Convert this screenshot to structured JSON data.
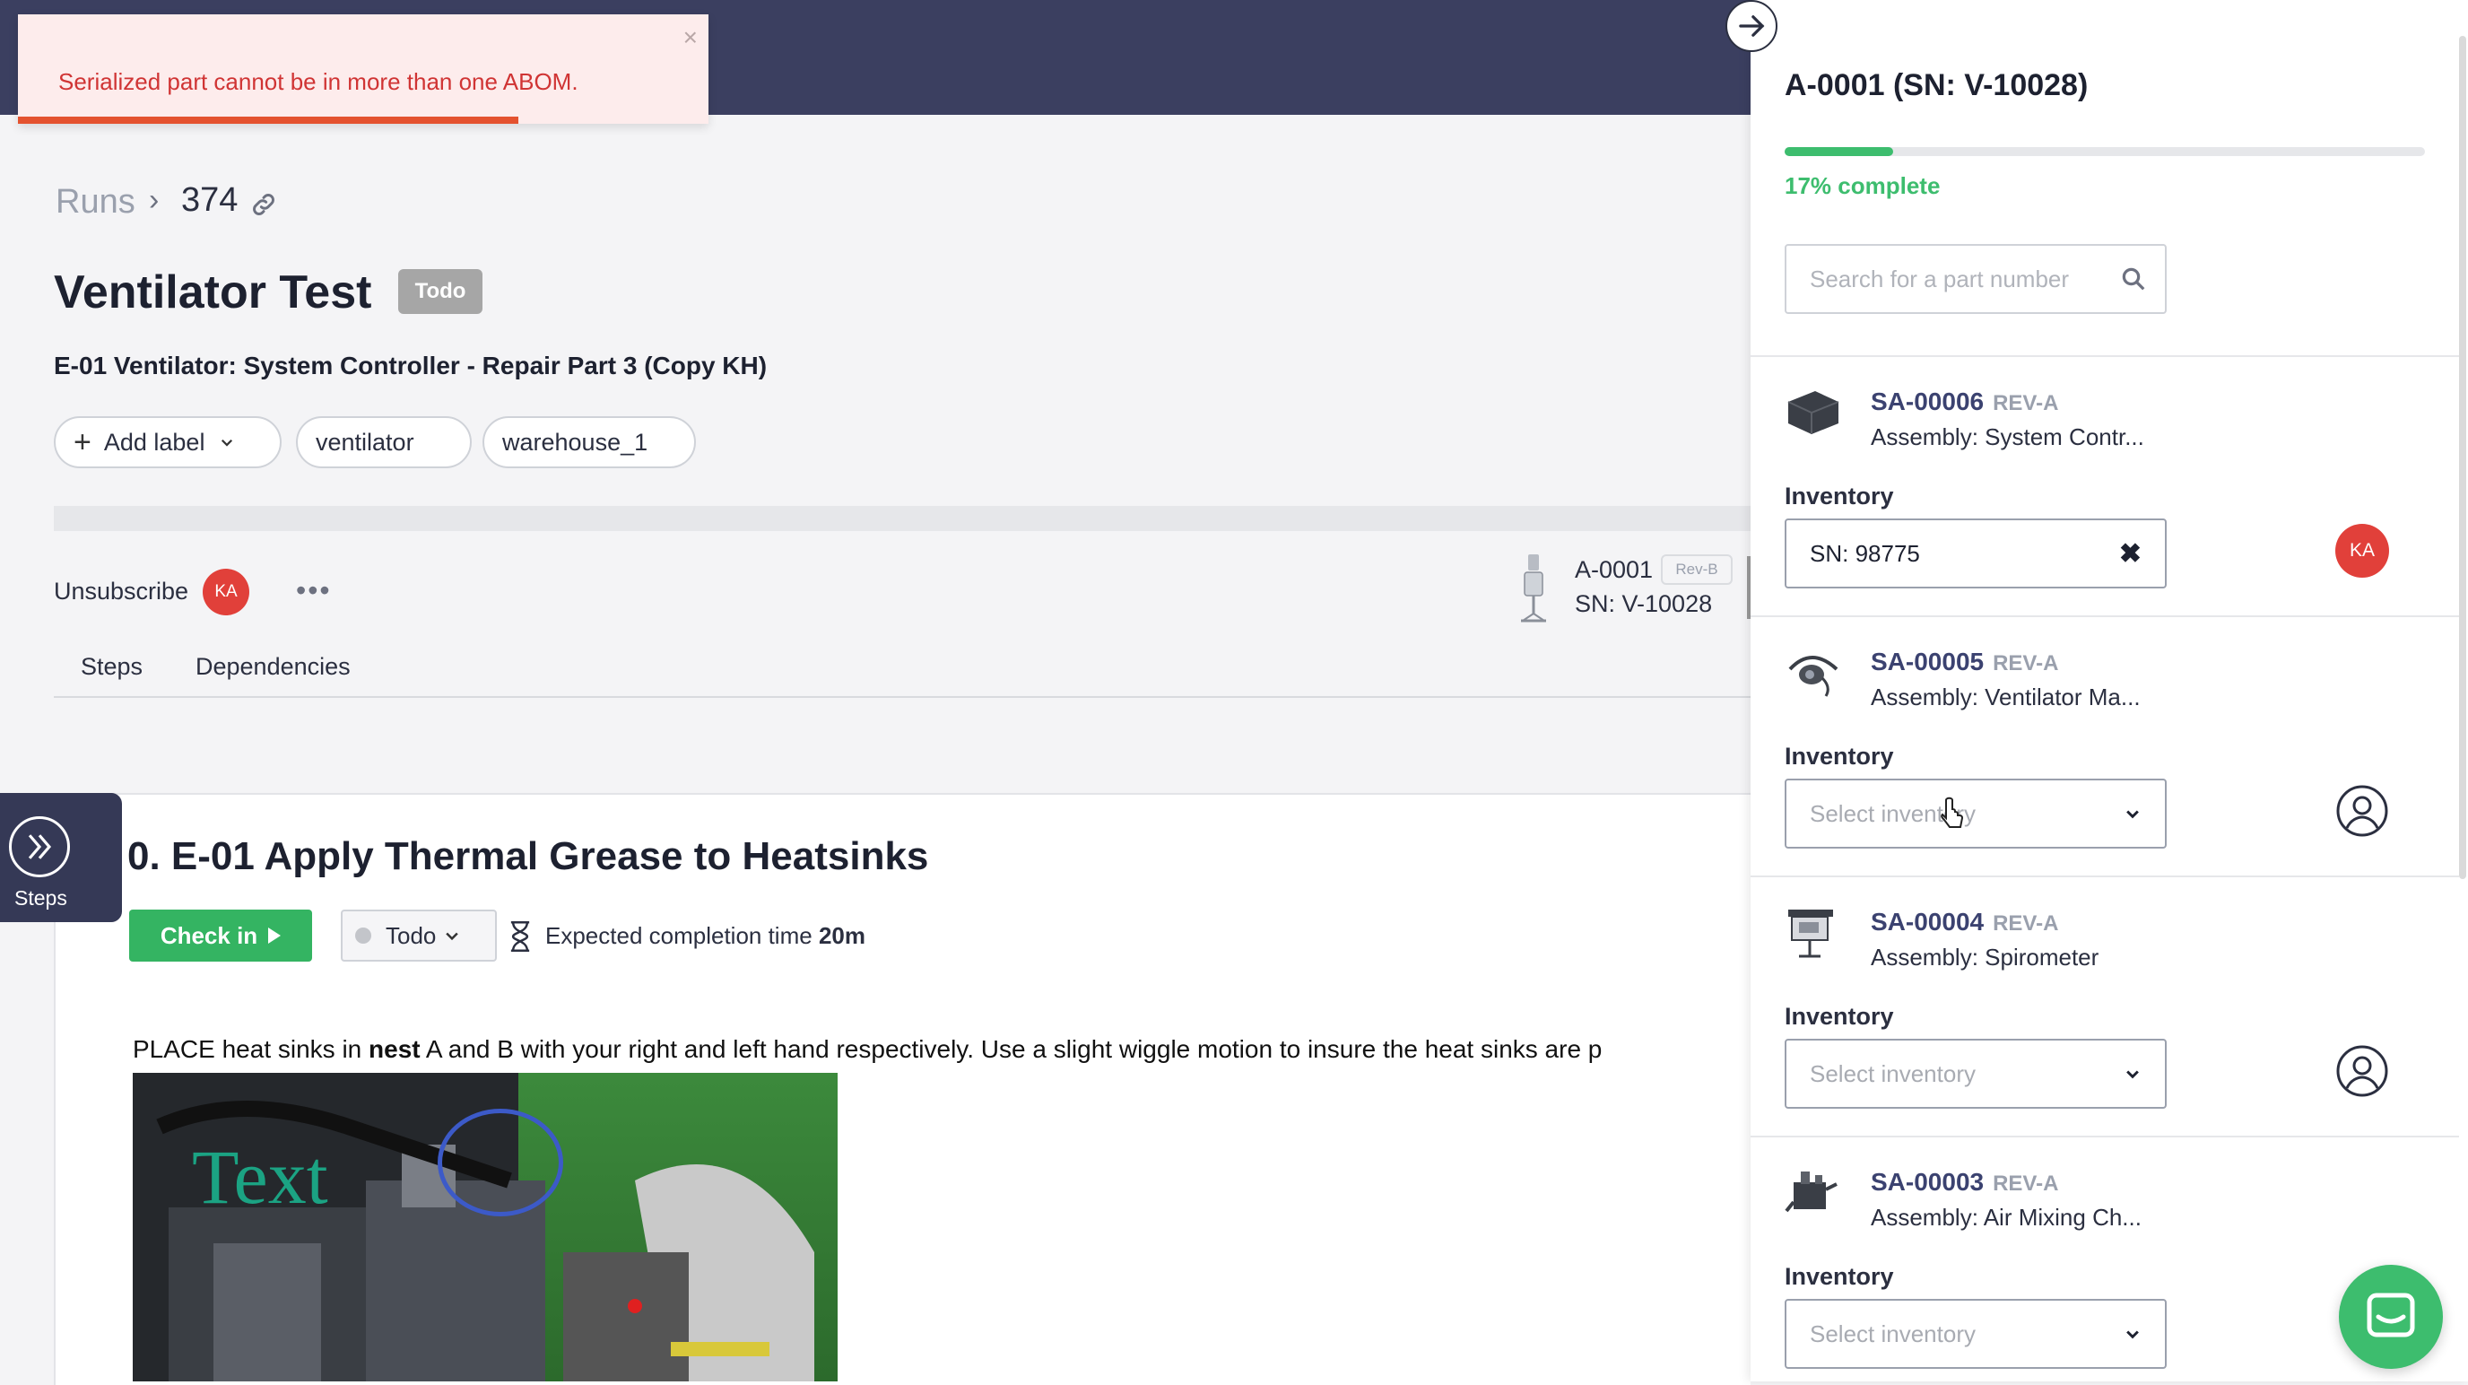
{
  "toast": {
    "message": "Serialized part cannot be in more than one ABOM.",
    "close": "×"
  },
  "breadcrumb": {
    "root": "Runs",
    "separator": "›",
    "run_number": "374"
  },
  "run": {
    "title": "Ventilator Test",
    "status": "Todo",
    "procedure": "E-01 Ventilator: System Controller - Repair Part 3 (Copy KH)"
  },
  "labels": {
    "add_label": "Add label",
    "items": [
      "ventilator",
      "warehouse_1"
    ]
  },
  "actions": {
    "unsubscribe": "Unsubscribe",
    "avatar_initials": "KA",
    "more": "•••"
  },
  "unit": {
    "part": "A-0001",
    "revision": "Rev-B",
    "serial": "SN: V-10028"
  },
  "tabs": [
    "Steps",
    "Dependencies"
  ],
  "steps_panel": {
    "label": "Steps"
  },
  "step": {
    "title": "0. E-01 Apply Thermal Grease to Heatsinks",
    "check_in": "Check in",
    "status": "Todo",
    "expected_label": "Expected completion time",
    "expected_value": "20m",
    "instruction_prefix": "PLACE heat sinks in ",
    "instruction_bold": "nest",
    "instruction_suffix": " A and B with your right and left hand respectively. Use a slight wiggle motion to insure the heat sinks are p",
    "image_overlay_text": "Text"
  },
  "side_panel": {
    "title": "A-0001 (SN: V-10028)",
    "progress": 0.17,
    "progress_label": "17% complete",
    "search_placeholder": "Search for a part number",
    "inventory_label": "Inventory",
    "select_placeholder": "Select inventory",
    "parts": [
      {
        "number": "SA-00006",
        "rev": "REV-A",
        "description": "Assembly: System Contr...",
        "inventory": "SN: 98775",
        "assignee": "KA"
      },
      {
        "number": "SA-00005",
        "rev": "REV-A",
        "description": "Assembly: Ventilator Ma...",
        "inventory": "",
        "assignee": ""
      },
      {
        "number": "SA-00004",
        "rev": "REV-A",
        "description": "Assembly: Spirometer",
        "inventory": "",
        "assignee": ""
      },
      {
        "number": "SA-00003",
        "rev": "REV-A",
        "description": "Assembly: Air Mixing Ch...",
        "inventory": "",
        "assignee": ""
      }
    ]
  },
  "colors": {
    "nav": "#3b3f60",
    "accent_green": "#34b462",
    "error_red": "#d03434",
    "part_link": "#3b4270"
  }
}
